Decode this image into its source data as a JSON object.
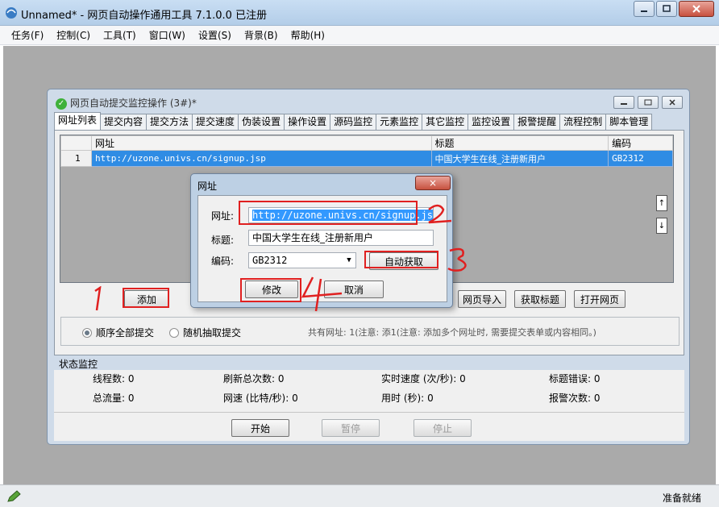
{
  "app": {
    "title": "Unnamed* - 网页自动操作通用工具 7.1.0.0 已注册",
    "minimize_icon": "minimize-icon",
    "maximize_icon": "maximize-icon",
    "close_icon": "close-icon"
  },
  "menu": {
    "items": [
      "任务(F)",
      "控制(C)",
      "工具(T)",
      "窗口(W)",
      "设置(S)",
      "背景(B)",
      "帮助(H)"
    ]
  },
  "child": {
    "title": "网页自动提交监控操作 (3#)*",
    "tabs": [
      "网址列表",
      "提交内容",
      "提交方法",
      "提交速度",
      "伪装设置",
      "操作设置",
      "源码监控",
      "元素监控",
      "其它监控",
      "监控设置",
      "报警提醒",
      "流程控制",
      "脚本管理"
    ],
    "table": {
      "headers": [
        "网址",
        "标题",
        "编码"
      ],
      "rows": [
        {
          "num": "1",
          "url": "http://uzone.univs.cn/signup.jsp",
          "title": "中国大学生在线_注册新用户",
          "encoding": "GB2312"
        }
      ]
    },
    "buttons": {
      "add": "添加",
      "import": "网页导入",
      "fetch_title": "获取标题",
      "open_page": "打开网页"
    },
    "options": {
      "sequential": "顺序全部提交",
      "random": "随机抽取提交",
      "note": "共有网址: 1(注意: 添1(注意: 添加多个网址时, 需要提交表单或内容相同。)"
    },
    "monitor": {
      "label": "状态监控",
      "threads_label": "线程数:",
      "threads": "0",
      "refresh_label": "刷新总次数:",
      "refresh": "0",
      "speed_label": "实时速度 (次/秒):",
      "speed": "0",
      "title_err_label": "标题错误:",
      "title_err": "0",
      "traffic_label": "总流量:",
      "traffic": "0",
      "netspeed_label": "网速 (比特/秒):",
      "netspeed": "0",
      "time_label": "用时 (秒):",
      "time": "0",
      "alarm_label": "报警次数:",
      "alarm": "0"
    },
    "controls": {
      "start": "开始",
      "pause": "暂停",
      "stop": "停止"
    }
  },
  "dialog": {
    "title": "网址",
    "close": "×",
    "url_label": "网址:",
    "url_value": "http://uzone.univs.cn/signup.jsp",
    "title_label": "标题:",
    "title_value": "中国大学生在线_注册新用户",
    "encoding_label": "编码:",
    "encoding_value": "GB2312",
    "auto_fetch": "自动获取",
    "modify": "修改",
    "cancel": "取消"
  },
  "annotations": {
    "one": "1",
    "two": "2",
    "three": "3",
    "four": "4",
    "color": "#e02020"
  },
  "status": {
    "ready": "准备就绪"
  }
}
